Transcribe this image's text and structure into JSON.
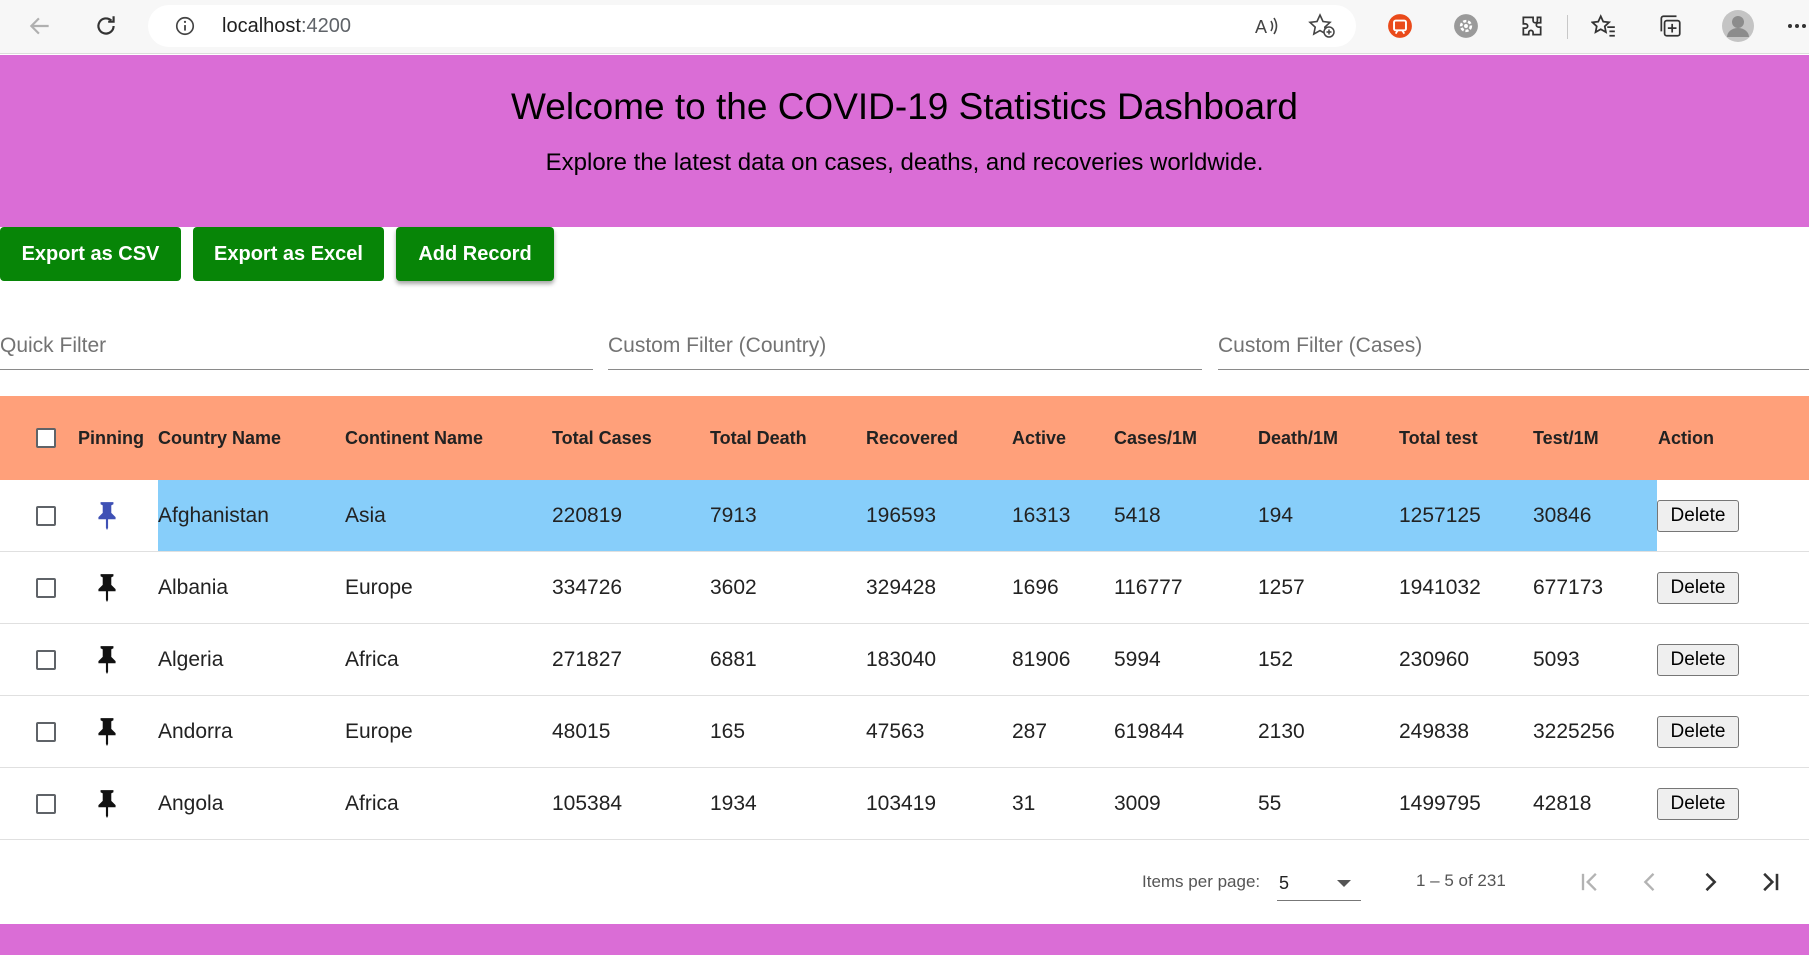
{
  "browser": {
    "url_host": "localhost",
    "url_port": ":4200"
  },
  "hero": {
    "title": "Welcome to the COVID-19 Statistics Dashboard",
    "subtitle": "Explore the latest data on cases, deaths, and recoveries worldwide.",
    "background": "#da6dd6"
  },
  "toolbar": {
    "export_csv": "Export as CSV",
    "export_excel": "Export as Excel",
    "add_record": "Add Record",
    "button_color": "#078507"
  },
  "filters": {
    "quick_placeholder": "Quick Filter",
    "country_placeholder": "Custom Filter (Country)",
    "cases_placeholder": "Custom Filter (Cases)"
  },
  "table": {
    "header_color": "#ffa07a",
    "highlight_color": "#87cefa",
    "columns": [
      "Pinning",
      "Country Name",
      "Continent Name",
      "Total Cases",
      "Total Death",
      "Recovered",
      "Active",
      "Cases/1M",
      "Death/1M",
      "Total test",
      "Test/1M",
      "Action"
    ],
    "rows": [
      {
        "country": "Afghanistan",
        "continent": "Asia",
        "total_cases": "220819",
        "total_death": "7913",
        "recovered": "196593",
        "active": "16313",
        "cases_1m": "5418",
        "death_1m": "194",
        "total_test": "1257125",
        "test_1m": "30846",
        "action": "Delete",
        "pinned": true
      },
      {
        "country": "Albania",
        "continent": "Europe",
        "total_cases": "334726",
        "total_death": "3602",
        "recovered": "329428",
        "active": "1696",
        "cases_1m": "116777",
        "death_1m": "1257",
        "total_test": "1941032",
        "test_1m": "677173",
        "action": "Delete",
        "pinned": false
      },
      {
        "country": "Algeria",
        "continent": "Africa",
        "total_cases": "271827",
        "total_death": "6881",
        "recovered": "183040",
        "active": "81906",
        "cases_1m": "5994",
        "death_1m": "152",
        "total_test": "230960",
        "test_1m": "5093",
        "action": "Delete",
        "pinned": false
      },
      {
        "country": "Andorra",
        "continent": "Europe",
        "total_cases": "48015",
        "total_death": "165",
        "recovered": "47563",
        "active": "287",
        "cases_1m": "619844",
        "death_1m": "2130",
        "total_test": "249838",
        "test_1m": "3225256",
        "action": "Delete",
        "pinned": false
      },
      {
        "country": "Angola",
        "continent": "Africa",
        "total_cases": "105384",
        "total_death": "1934",
        "recovered": "103419",
        "active": "31",
        "cases_1m": "3009",
        "death_1m": "55",
        "total_test": "1499795",
        "test_1m": "42818",
        "action": "Delete",
        "pinned": false
      }
    ]
  },
  "paginator": {
    "items_per_page_label": "Items per page:",
    "items_per_page_value": "5",
    "range_label": "1 – 5 of 231"
  }
}
